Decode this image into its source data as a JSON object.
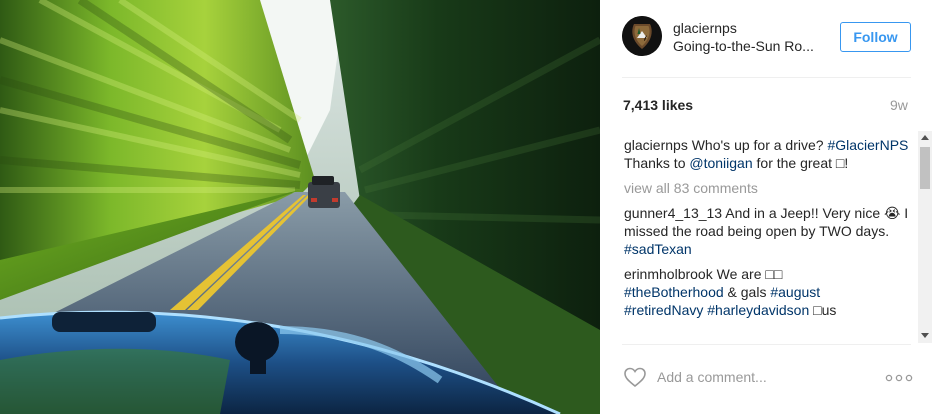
{
  "post": {
    "username": "glaciernps",
    "location": "Going-to-the-Sun Ro...",
    "follow_label": "Follow",
    "likes": "7,413 likes",
    "time_ago": "9w"
  },
  "comments": {
    "caption": {
      "user": "glaciernps",
      "text": " Who's up for a drive? ",
      "tag": "#GlacierNPS",
      "line2_prefix": "Thanks to ",
      "mention": "@toniigan",
      "line2_suffix": " for the great □!"
    },
    "view_all": "view all 83 comments",
    "items": [
      {
        "user": "gunner4_13_13",
        "text": " And in a Jeep!! Very nice 😭 I missed the road being open by TWO days. ",
        "tag": "#sadTexan"
      },
      {
        "user": "erinmholbrook",
        "text": " We are □□ ",
        "tags_line": "#theBotherhood",
        "mid": " & gals ",
        "tag2": "#august",
        "tag3": "#retiredNavy",
        "tag4": "#harleydavidson",
        "end": " □us"
      }
    ]
  },
  "add_comment": {
    "placeholder": "Add a comment..."
  },
  "icons": {
    "heart": "heart-icon",
    "more": "more-options-icon",
    "avatar": "nps-arrowhead-logo"
  },
  "colors": {
    "link_blue": "#003569",
    "follow_blue": "#3897f0",
    "muted": "#999999"
  }
}
